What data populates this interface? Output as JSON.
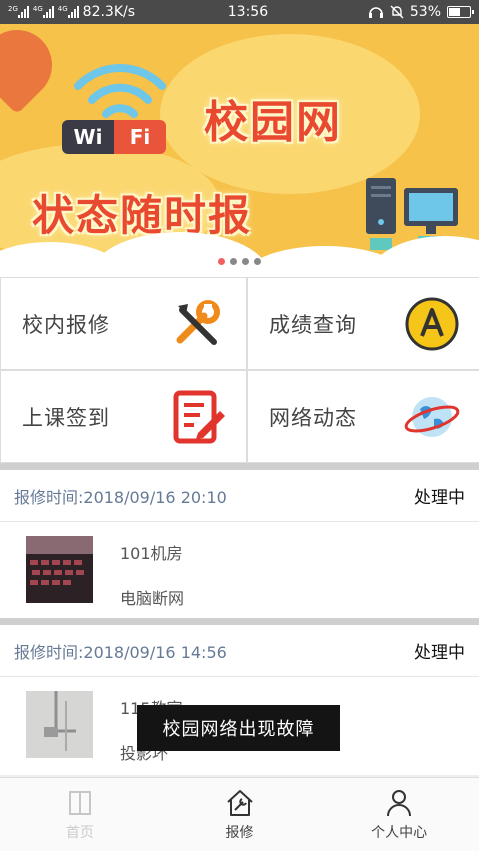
{
  "status_bar": {
    "net_tag_1": "2G",
    "net_tag_2": "4G",
    "net_tag_3": "4G",
    "speed": "82.3K/s",
    "time": "13:56",
    "battery": "53%",
    "battery_level": 0.53
  },
  "banner": {
    "wifi_left": "Wi",
    "wifi_right": "Fi",
    "title_top": "校园网",
    "title_bottom": "状态随时报",
    "slide_count": 4,
    "active_slide": 0
  },
  "menu": {
    "repair": "校内报修",
    "grades": "成绩查询",
    "checkin": "上课签到",
    "network_news": "网络动态"
  },
  "repairs": [
    {
      "time": "报修时间:2018/09/16 20:10",
      "status": "处理中",
      "place": "101机房",
      "issue": "电脑断网"
    },
    {
      "time": "报修时间:2018/09/16 14:56",
      "status": "处理中",
      "place": "115教室",
      "issue": "投影坏"
    }
  ],
  "toast": "校园网络出现故障",
  "tabs": {
    "home": "首页",
    "repair": "报修",
    "profile": "个人中心"
  },
  "colors": {
    "banner_bg": "#f6c24a",
    "title_red": "#e8492f",
    "time_blue": "#667a96"
  }
}
